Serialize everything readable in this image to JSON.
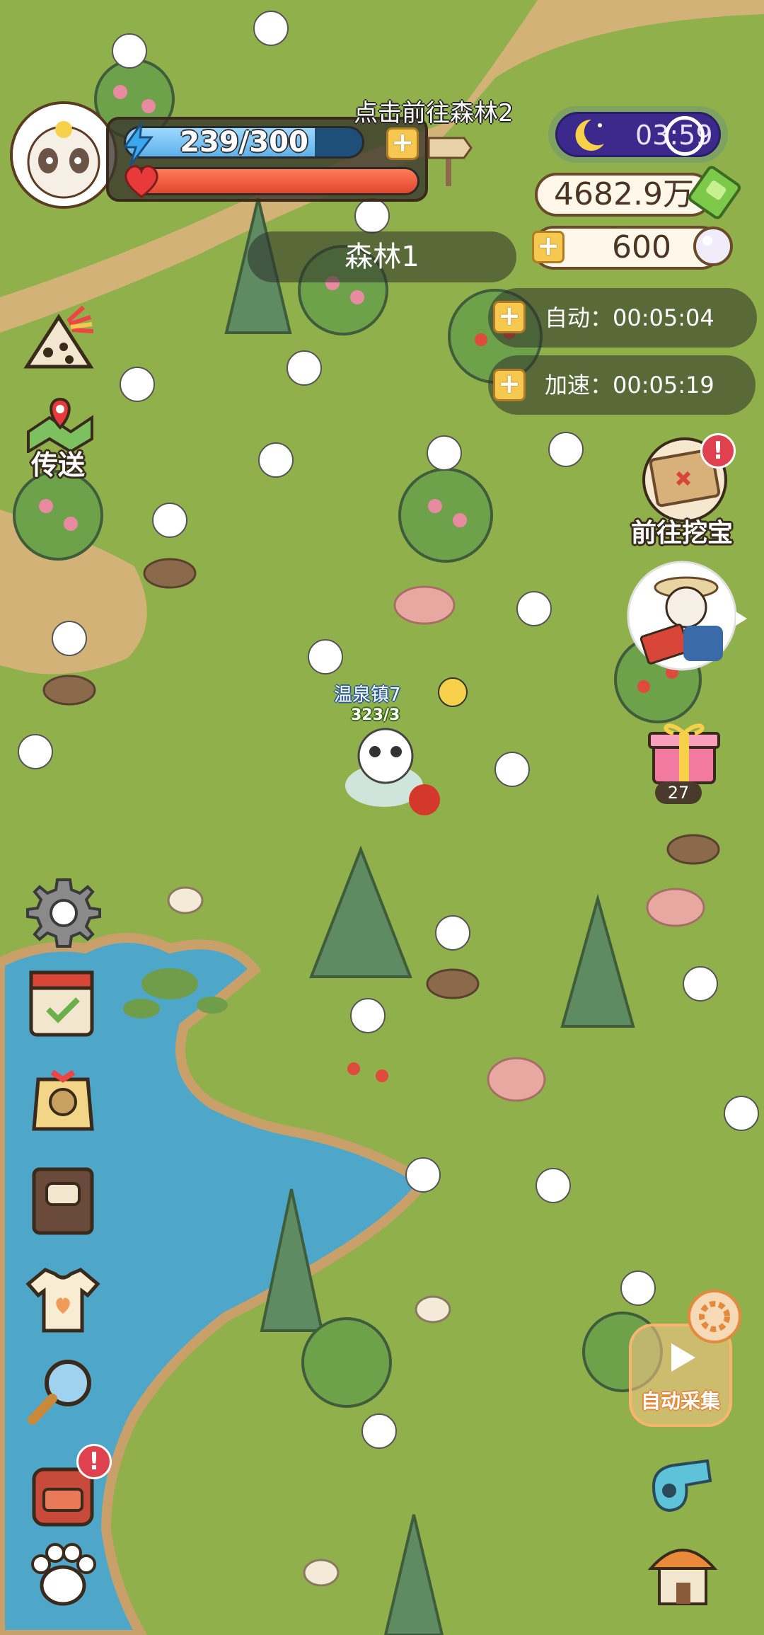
{
  "hud": {
    "energy_text": "239/300",
    "energy_fraction": 0.8,
    "health_fraction": 1.0,
    "hint": "点击前往森林2",
    "area_name": "森林1",
    "night_timer": "03:59",
    "cash": "4682.9万",
    "pearls": "600",
    "auto_label": "自动：",
    "auto_timer": "00:05:04",
    "speed_label": "加速：",
    "speed_timer": "00:05:19"
  },
  "left_menu": {
    "teleport_label": "传送"
  },
  "right_menu": {
    "treasure_label": "前往挖宝",
    "treasure_badge": "!",
    "gift_count": "27",
    "auto_collect_label": "自动采集"
  },
  "bag_badge": "!",
  "player": {
    "name": "温泉镇7",
    "hp": "323/3"
  },
  "colors": {
    "grass": "#8fb04a",
    "water": "#4ea6c8",
    "path": "#d9b37c",
    "accent_yellow": "#f7c850",
    "alert_red": "#e0414e"
  },
  "icons": [
    "mountain-bag-icon",
    "teleport-map-icon",
    "settings-gear-icon",
    "calendar-icon",
    "bag-tag-icon",
    "recipe-book-icon",
    "tshirt-icon",
    "magnifier-icon",
    "backpack-icon",
    "paw-icon",
    "whistle-icon",
    "home-icon",
    "treasure-map-icon",
    "npc-chat-icon",
    "gift-box-icon",
    "auto-collect-icon",
    "crescent-moon-icon",
    "cash-stack-icon",
    "pearl-icon"
  ]
}
